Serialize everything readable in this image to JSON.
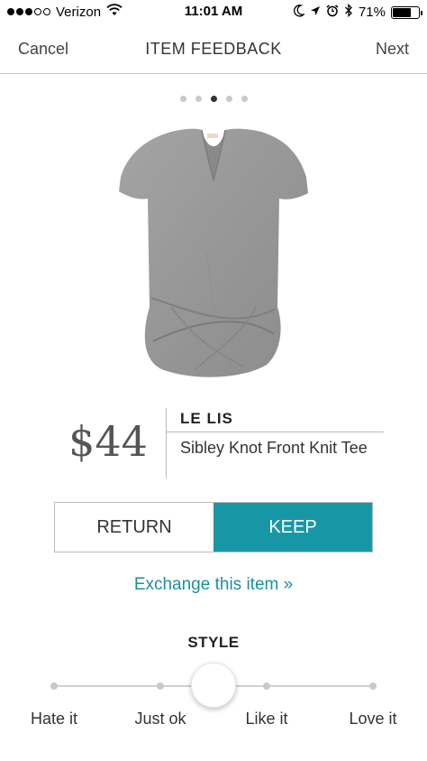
{
  "status_bar": {
    "carrier": "Verizon",
    "time": "11:01 AM",
    "battery": "71%",
    "battery_level": 0.71,
    "icons": [
      "signal-dots-icon",
      "wifi-icon",
      "moon-icon",
      "location-icon",
      "alarm-icon",
      "bluetooth-icon",
      "battery-icon"
    ]
  },
  "nav": {
    "cancel_label": "Cancel",
    "title": "ITEM FEEDBACK",
    "next_label": "Next"
  },
  "carousel": {
    "count": 5,
    "active_index": 2
  },
  "product": {
    "image_icon": "gray-knot-tee-image",
    "price": "$44",
    "brand": "LE LIS",
    "name": "Sibley Knot Front Knit Tee"
  },
  "actions": {
    "return_label": "RETURN",
    "keep_label": "KEEP",
    "keep_color": "#1797a6",
    "exchange_link": "Exchange this item »"
  },
  "style_rating": {
    "title": "STYLE",
    "options": [
      "Hate it",
      "Just ok",
      "Like it",
      "Love it"
    ],
    "selected_position": 0.5
  }
}
